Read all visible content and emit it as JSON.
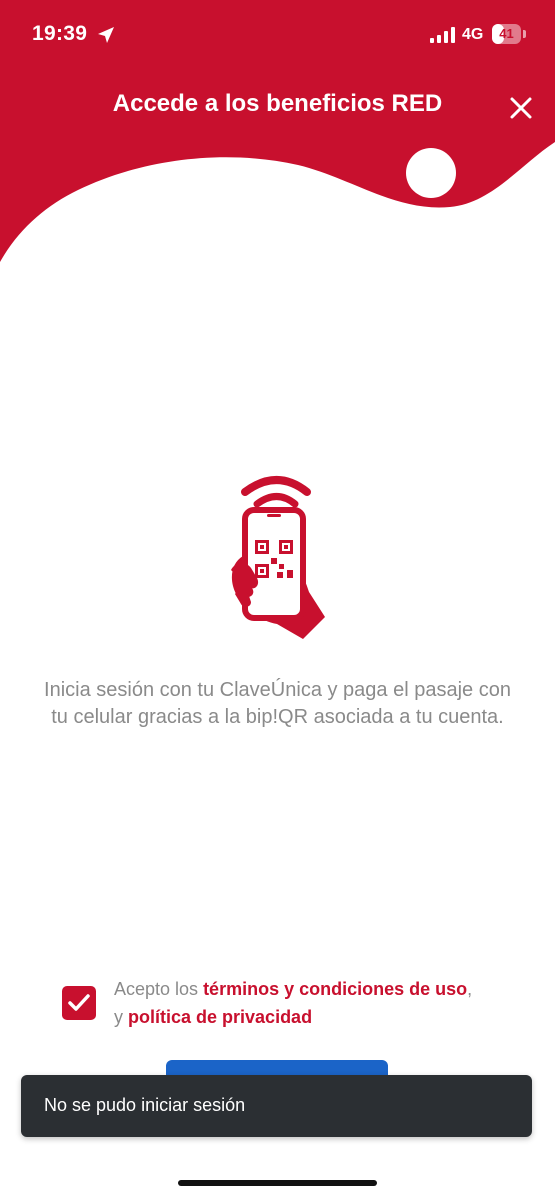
{
  "status_bar": {
    "time": "19:39",
    "network": "4G",
    "battery": "41",
    "battery_level_percent": 41,
    "location_icon": "location-arrow-icon",
    "signal_icon": "cellular-signal-icon"
  },
  "header": {
    "title": "Accede a los beneficios RED",
    "close_icon": "close-icon",
    "color": "#c8102e"
  },
  "main": {
    "illustration_icon": "phone-qr-wireless-icon",
    "description": "Inicia sesión con tu ClaveÚnica y paga el pasaje con tu celular gracias a la bip!QR asociada a tu cuenta."
  },
  "consent": {
    "checked": true,
    "prefix": "Acepto los ",
    "terms_link": "términos y condiciones de uso",
    "comma": ",",
    "conjunction": "y ",
    "privacy_link": "política de privacidad"
  },
  "toast": {
    "message": "No se pudo iniciar sesión"
  },
  "colors": {
    "accent": "#c8102e",
    "button": "#1b64c8",
    "toast_bg": "#2b2f33",
    "body_text": "#8a8a8a"
  }
}
